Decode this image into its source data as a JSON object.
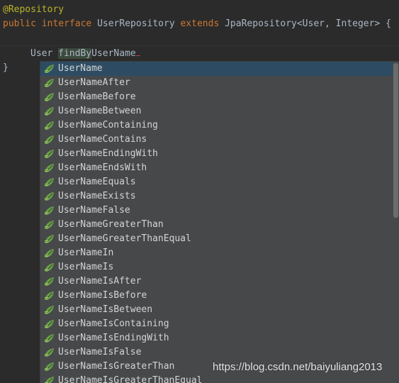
{
  "editor": {
    "annotation": "@Repository",
    "decl": {
      "kw_public": "public",
      "kw_interface": "interface",
      "name": "UserRepository",
      "kw_extends": "extends",
      "parent": "JpaRepository<User, Integer> {"
    },
    "stub": {
      "return_type": "User",
      "method_prefix": "findBy",
      "method_rest": "UserName"
    },
    "closing_brace": "}"
  },
  "completion": {
    "items": [
      "UserName",
      "UserNameAfter",
      "UserNameBefore",
      "UserNameBetween",
      "UserNameContaining",
      "UserNameContains",
      "UserNameEndingWith",
      "UserNameEndsWith",
      "UserNameEquals",
      "UserNameExists",
      "UserNameFalse",
      "UserNameGreaterThan",
      "UserNameGreaterThanEqual",
      "UserNameIn",
      "UserNameIs",
      "UserNameIsAfter",
      "UserNameIsBefore",
      "UserNameIsBetween",
      "UserNameIsContaining",
      "UserNameIsEndingWith",
      "UserNameIsFalse",
      "UserNameIsGreaterThan",
      "UserNameIsGreaterThanEqual"
    ],
    "item_icon": "spring-data-leaf-icon"
  },
  "watermark": {
    "text": "https://blog.csdn.net/baiyuliang2013"
  },
  "colors": {
    "background": "#2b2b2b",
    "keyword": "#cc7832",
    "annotation": "#bbb529",
    "popup_bg": "#46484a",
    "selection": "#2d4c63",
    "icon_green": "#6a9f4a"
  }
}
